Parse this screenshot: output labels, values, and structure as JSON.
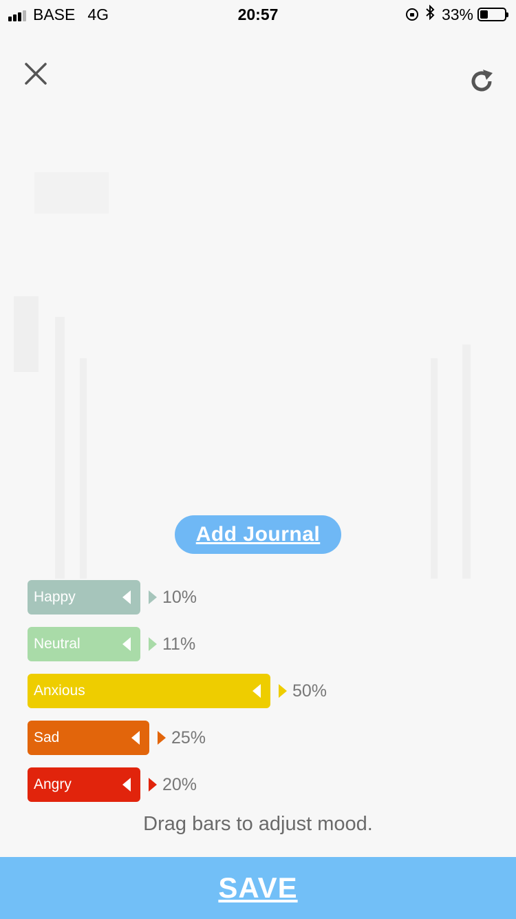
{
  "status_bar": {
    "carrier": "BASE",
    "network": "4G",
    "time": "20:57",
    "battery": "33%",
    "battery_level": 0.33
  },
  "controls": {
    "close_icon": "close-icon",
    "refresh_icon": "refresh-icon"
  },
  "add_journal_label": "Add Journal",
  "moods": [
    {
      "name": "Happy",
      "percent": "10%",
      "value": 10,
      "color": "#a6c5bb"
    },
    {
      "name": "Neutral",
      "percent": "11%",
      "value": 11,
      "color": "#a9dba8"
    },
    {
      "name": "Anxious",
      "percent": "50%",
      "value": 50,
      "color": "#eecd00"
    },
    {
      "name": "Sad",
      "percent": "25%",
      "value": 25,
      "color": "#e2650b"
    },
    {
      "name": "Angry",
      "percent": "20%",
      "value": 20,
      "color": "#e1240c"
    }
  ],
  "hint": "Drag bars to adjust mood.",
  "save_label": "SAVE"
}
